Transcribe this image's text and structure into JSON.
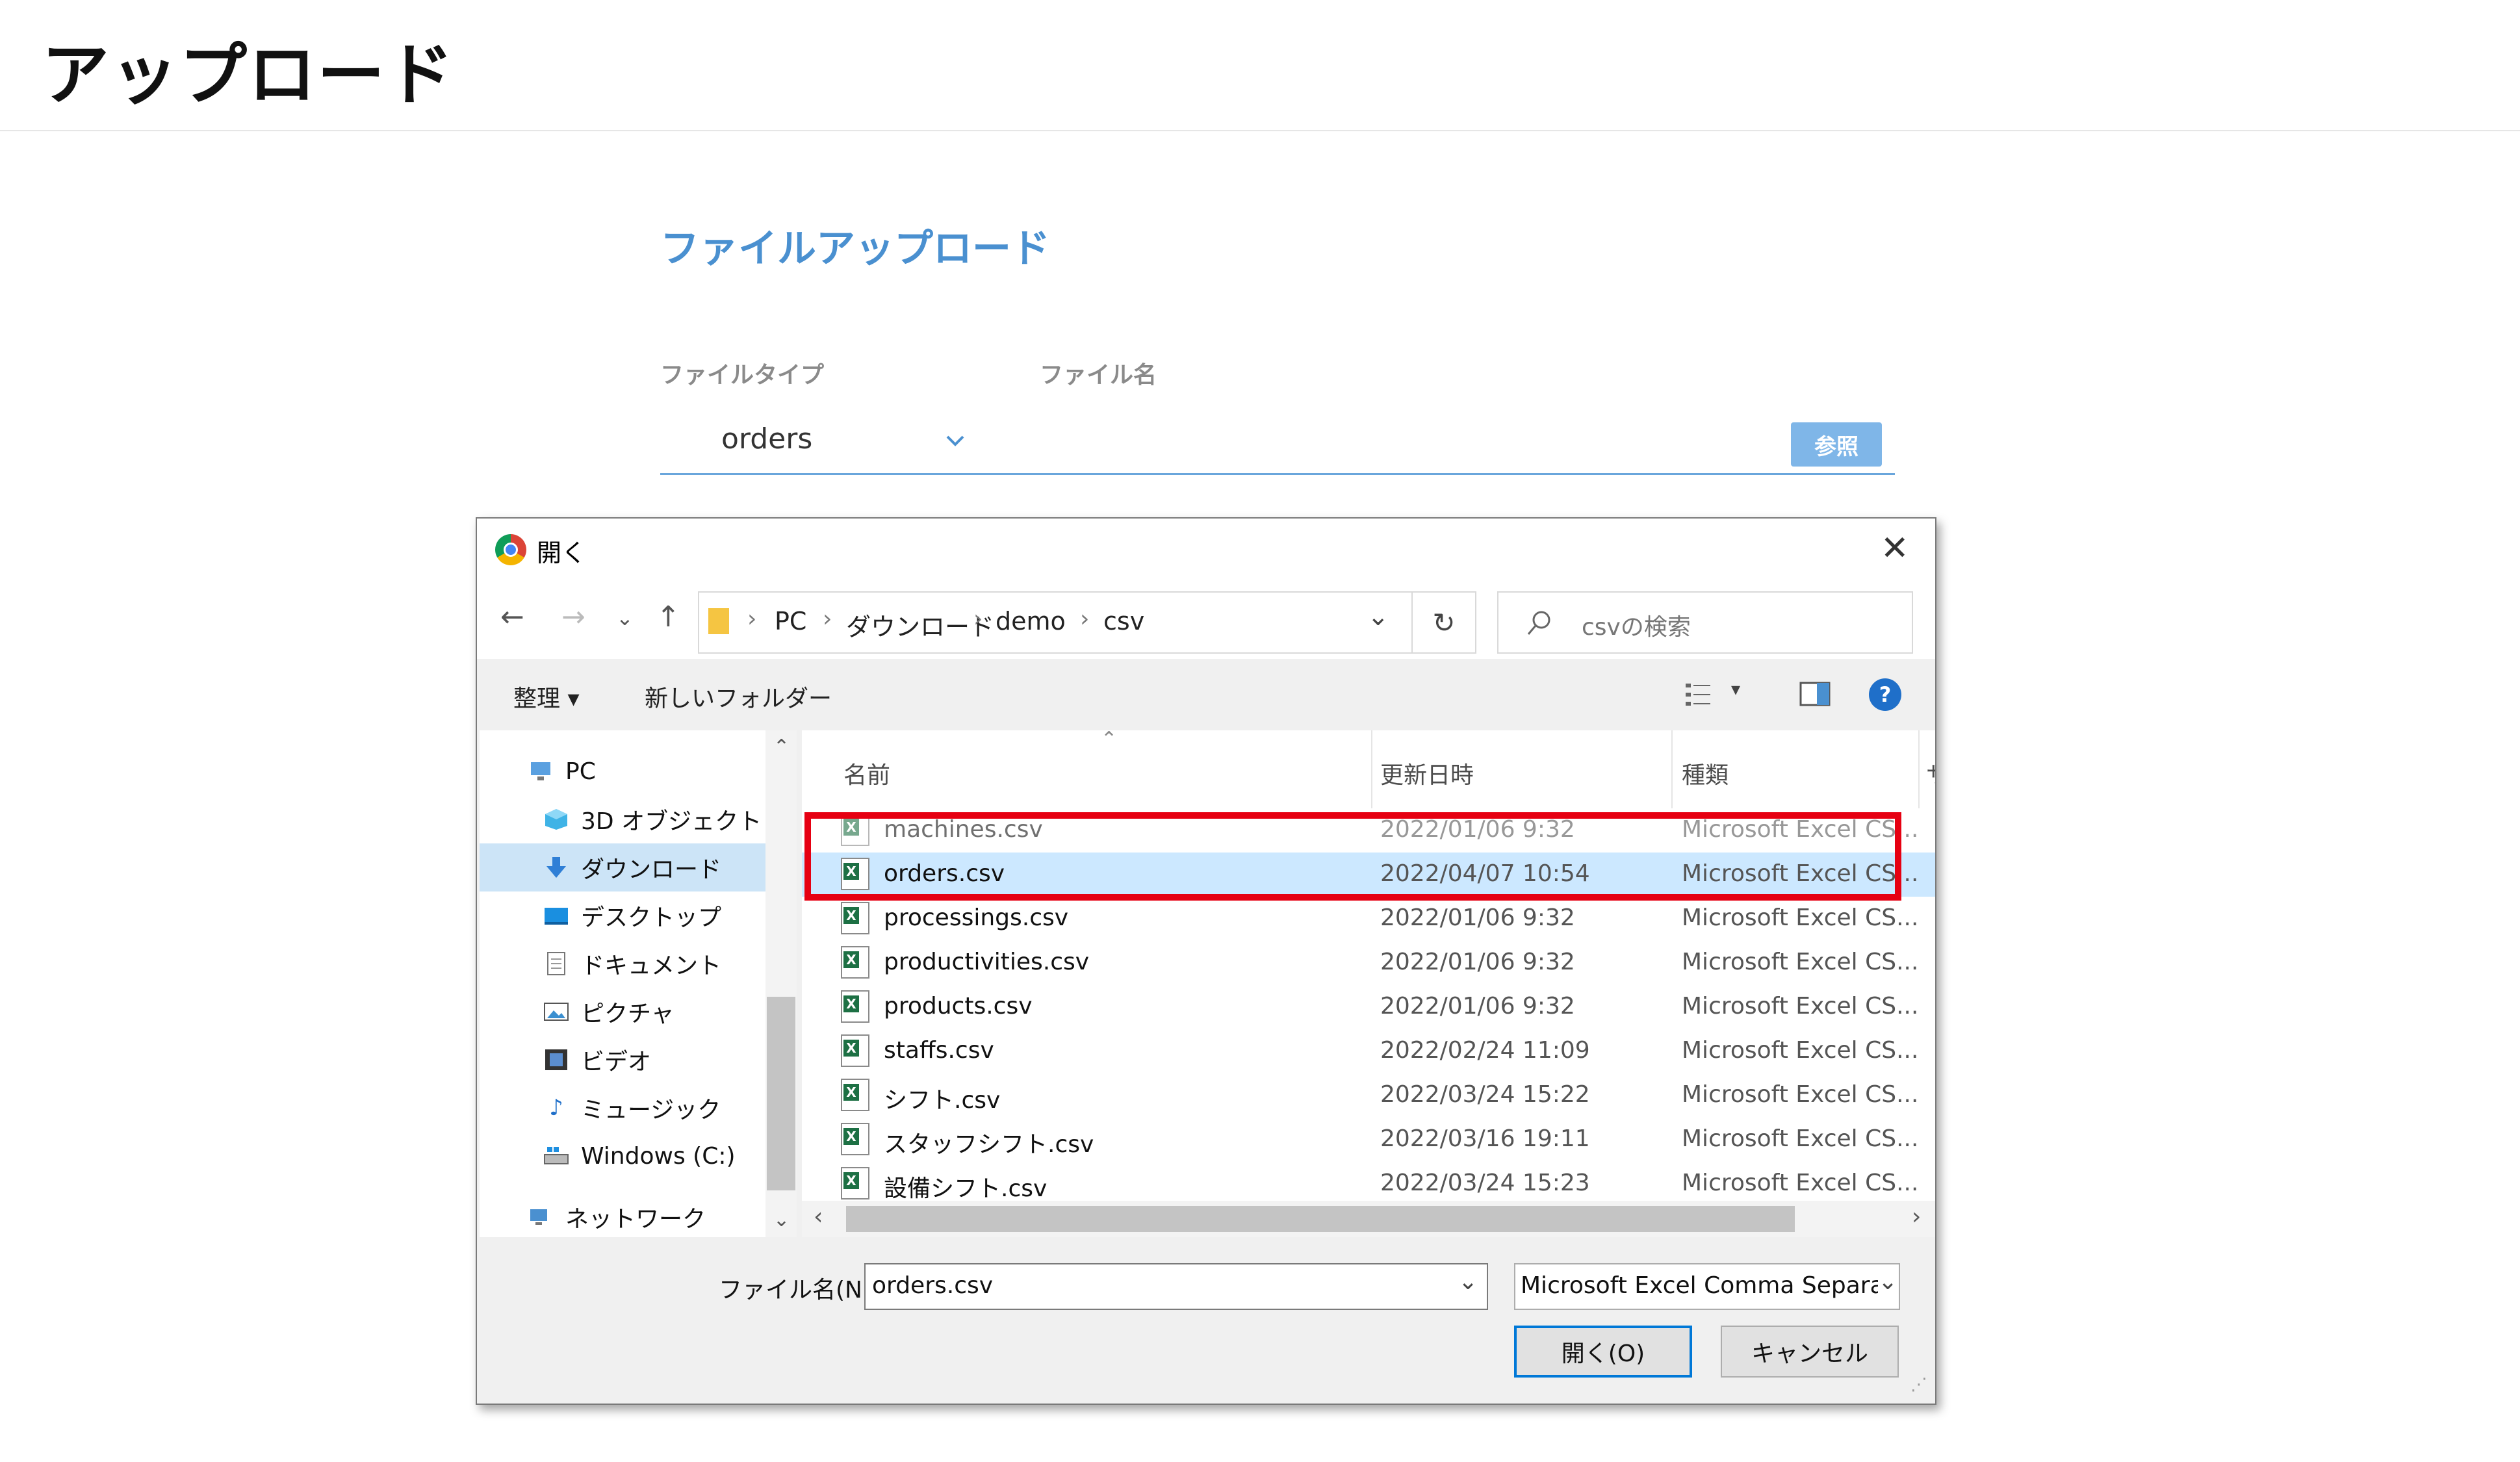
{
  "page": {
    "title": "アップロード",
    "section_title": "ファイルアップロード",
    "file_type_label": "ファイルタイプ",
    "file_name_label": "ファイル名",
    "file_type_value": "orders",
    "browse_button": "参照"
  },
  "dialog": {
    "title": "開く",
    "close_label": "✕",
    "breadcrumb": [
      "PC",
      "ダウンロード",
      "demo",
      "csv"
    ],
    "search_placeholder": "csvの検索",
    "toolbar": {
      "organize": "整理 ▾",
      "new_folder": "新しいフォルダー"
    },
    "tree": [
      {
        "label": "PC",
        "icon": "pc-icon"
      },
      {
        "label": "3D オブジェクト",
        "icon": "3d-objects-icon"
      },
      {
        "label": "ダウンロード",
        "icon": "download-icon",
        "selected": true
      },
      {
        "label": "デスクトップ",
        "icon": "desktop-icon"
      },
      {
        "label": "ドキュメント",
        "icon": "documents-icon"
      },
      {
        "label": "ピクチャ",
        "icon": "pictures-icon"
      },
      {
        "label": "ビデオ",
        "icon": "videos-icon"
      },
      {
        "label": "ミュージック",
        "icon": "music-icon"
      },
      {
        "label": "Windows (C:)",
        "icon": "drive-icon"
      },
      {
        "label": "ネットワーク",
        "icon": "network-icon"
      }
    ],
    "columns": {
      "name": "名前",
      "date": "更新日時",
      "type": "種類",
      "size": "サ"
    },
    "files": [
      {
        "name": "machines.csv",
        "date": "2022/01/06 9:32",
        "type": "Microsoft Excel CS..."
      },
      {
        "name": "orders.csv",
        "date": "2022/04/07 10:54",
        "type": "Microsoft Excel CS...",
        "selected": true
      },
      {
        "name": "processings.csv",
        "date": "2022/01/06 9:32",
        "type": "Microsoft Excel CS..."
      },
      {
        "name": "productivities.csv",
        "date": "2022/01/06 9:32",
        "type": "Microsoft Excel CS..."
      },
      {
        "name": "products.csv",
        "date": "2022/01/06 9:32",
        "type": "Microsoft Excel CS..."
      },
      {
        "name": "staffs.csv",
        "date": "2022/02/24 11:09",
        "type": "Microsoft Excel CS..."
      },
      {
        "name": "シフト.csv",
        "date": "2022/03/24 15:22",
        "type": "Microsoft Excel CS..."
      },
      {
        "name": "スタッフシフト.csv",
        "date": "2022/03/16 19:11",
        "type": "Microsoft Excel CS..."
      },
      {
        "name": "設備シフト.csv",
        "date": "2022/03/24 15:23",
        "type": "Microsoft Excel CS..."
      }
    ],
    "filename_label": "ファイル名(N):",
    "filename_value": "orders.csv",
    "filter_value": "Microsoft Excel Comma Separa",
    "open_button": "開く(O)",
    "cancel_button": "キャンセル"
  },
  "colors": {
    "accent": "#4a90d0",
    "highlight": "#e60012",
    "selection": "#cce8ff"
  }
}
